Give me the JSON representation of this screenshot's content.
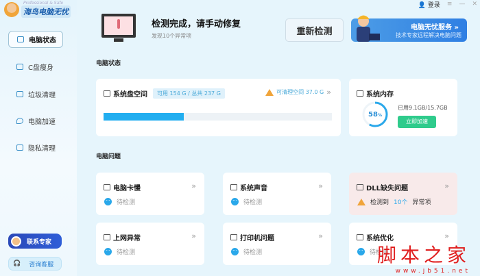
{
  "app": {
    "logo_sub": "Professional & Safe",
    "logo_name": "海鸟电脑无忧"
  },
  "topbar": {
    "login": "登录",
    "menu_icon": "≡",
    "min_icon": "—",
    "close_icon": "✕"
  },
  "sidebar": {
    "items": [
      {
        "label": "电脑状态",
        "active": true
      },
      {
        "label": "C盘瘦身"
      },
      {
        "label": "垃圾清理"
      },
      {
        "label": "电脑加速"
      },
      {
        "label": "隐私清理"
      }
    ],
    "expert": "联系专家",
    "service": "咨询客服"
  },
  "header": {
    "title": "检测完成，请手动修复",
    "subtitle": "发现10个异常项",
    "rescan": "重新检测",
    "banner_title": "电脑无忧服务 »",
    "banner_sub": "技术专家远程解决电脑问题"
  },
  "status": {
    "section": "电脑状态",
    "disk": {
      "title": "系统盘空间",
      "capacity": "可用 154 G / 总共 237 G",
      "cleanable": "可清理空间 37.0 G",
      "used_fraction": 0.35
    },
    "memory": {
      "title": "系统内存",
      "percent": "58",
      "unit": "%",
      "used": "已用9.1GB/15.7GB",
      "boost": "立即加速",
      "fraction": 0.58
    }
  },
  "problems": {
    "section": "电脑问题",
    "items": [
      {
        "title": "电脑卡慢",
        "status": "待检测"
      },
      {
        "title": "系统声音",
        "status": "待检测"
      },
      {
        "title": "DLL缺失问题",
        "status_pre": "检测到",
        "count": "10个",
        "status_post": "异常项"
      },
      {
        "title": "上网异常",
        "status": "待检测"
      },
      {
        "title": "打印机问题",
        "status": "待检测"
      },
      {
        "title": "系统优化",
        "status": "待检测"
      }
    ]
  },
  "watermark": {
    "name": "脚本之家",
    "url": "www.jb51.net"
  },
  "colors": {
    "accent": "#2aa8ea",
    "warn": "#f0a43a",
    "boost": "#2fcb8c",
    "alert_card": "#f8eaea"
  }
}
